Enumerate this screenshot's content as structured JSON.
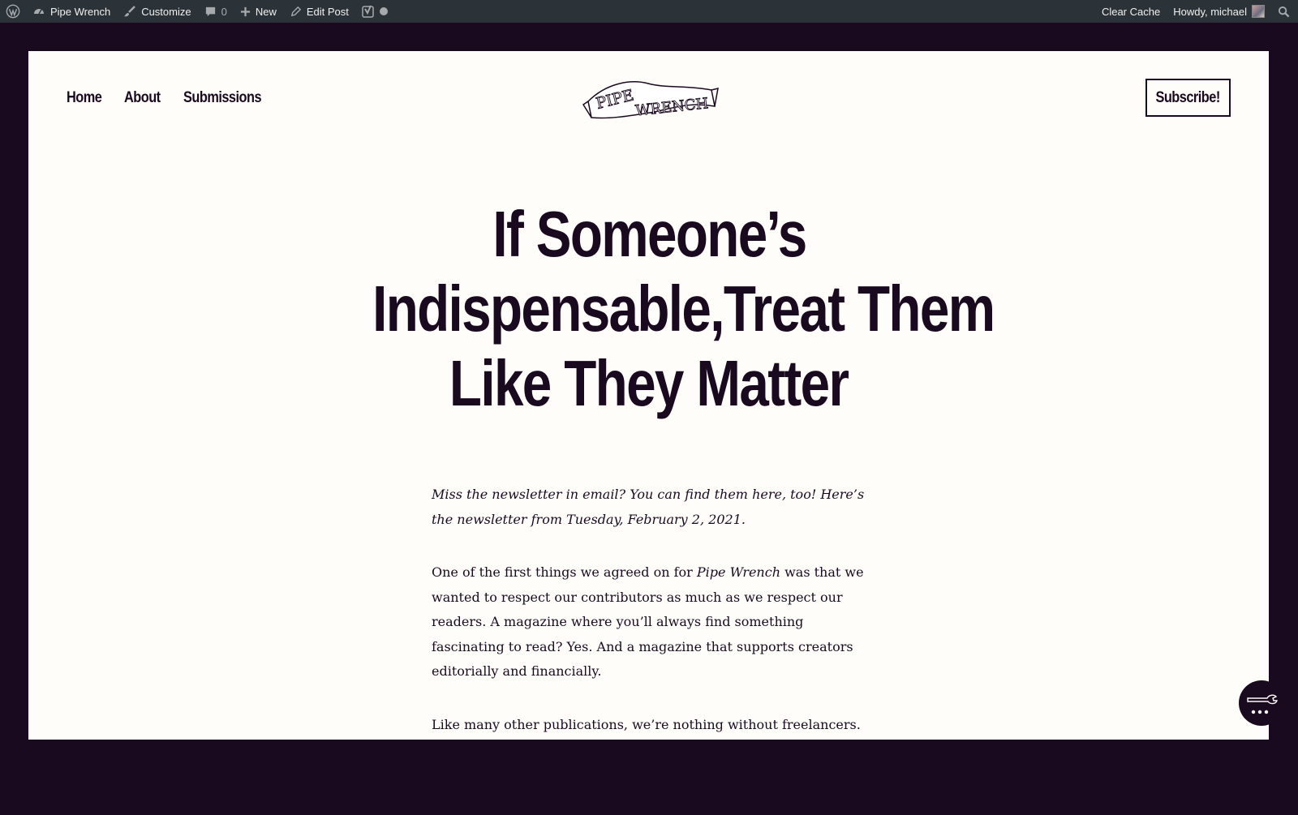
{
  "adminbar": {
    "site_name": "Pipe Wrench",
    "customize": "Customize",
    "comments_count": "0",
    "new": "New",
    "edit_post": "Edit Post",
    "clear_cache": "Clear Cache",
    "howdy": "Howdy, michael"
  },
  "nav": {
    "items": [
      "Home",
      "About",
      "Submissions"
    ]
  },
  "logo": {
    "line1": "PIPE",
    "line2": "WRENCH"
  },
  "subscribe_label": "Subscribe!",
  "post": {
    "title_lines": [
      "If Someone’s",
      "Indispensable,Treat Them",
      "Like They Matter"
    ],
    "intro": "Miss the newsletter in email? You can find them here, too! Here’s the newsletter from Tuesday, February 2, 2021.",
    "para1_before": "One of the first things we agreed on for ",
    "para1_em": "Pipe Wrench",
    "para1_after": " was that we wanted to respect our contributors as much as we respect our readers. A magazine where you’ll always find something fascinating to read? Yes. And a magazine that supports creators editorially and financially.",
    "para2": "Like many other publications, we’re nothing without freelancers. Yet writers are not always given respect or fair pay in the magazine business."
  },
  "colors": {
    "ink": "#1a0a1f",
    "paper": "#fffdfa",
    "adminbar": "#2c3338"
  }
}
